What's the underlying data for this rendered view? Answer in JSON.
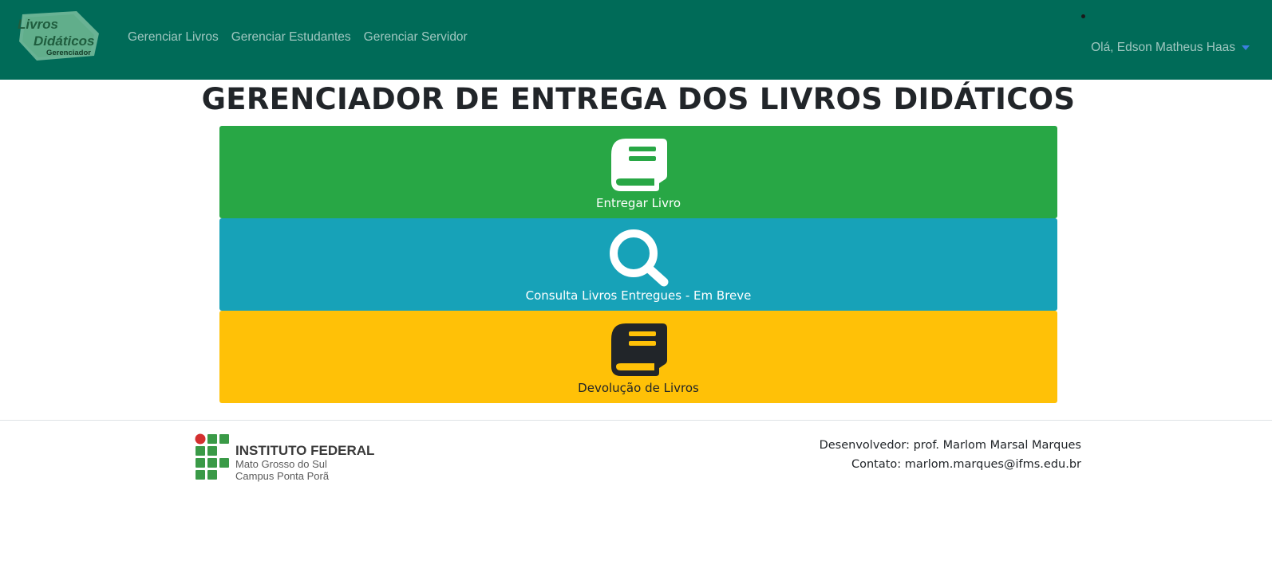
{
  "app": {
    "logo_text": [
      "Livros",
      "Didáticos",
      "Gerenciador"
    ]
  },
  "navbar": {
    "links": [
      {
        "label": "Gerenciar Livros"
      },
      {
        "label": "Gerenciar Estudantes"
      },
      {
        "label": "Gerenciar Servidor"
      }
    ],
    "user_greeting": "Olá, Edson Matheus Haas"
  },
  "main": {
    "title": "GERENCIADOR DE ENTREGA DOS LIVROS DIDÁTICOS",
    "actions": [
      {
        "label": "Entregar Livro",
        "icon": "book-icon",
        "color": "#28a745"
      },
      {
        "label": "Consulta Livros Entregues - Em Breve",
        "icon": "search-icon",
        "color": "#17a2b8"
      },
      {
        "label": "Devolução de Livros",
        "icon": "book-icon",
        "color": "#ffc107"
      }
    ]
  },
  "footer": {
    "institution": {
      "name": "INSTITUTO FEDERAL",
      "state": "Mato Grosso do Sul",
      "campus": "Campus Ponta Porã"
    },
    "developer": "Desenvolvedor: prof. Marlom Marsal Marques",
    "contact": "Contato: marlom.marques@ifms.edu.br"
  },
  "colors": {
    "navbar": "#006b58",
    "green": "#28a745",
    "blue": "#17a2b8",
    "yellow": "#ffc107"
  }
}
